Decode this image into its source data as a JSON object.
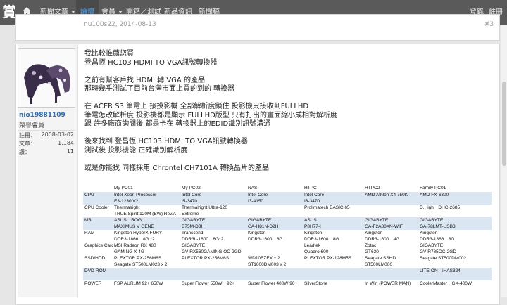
{
  "nav": {
    "logo": "賞",
    "items": [
      {
        "label": "新聞文章",
        "has_caret": true
      },
      {
        "label": "論壇",
        "active": true
      },
      {
        "label": "會員",
        "has_caret": true
      },
      {
        "label": "開箱／測試"
      },
      {
        "label": "新品資訊"
      },
      {
        "label": "新聞稿"
      }
    ],
    "login": "登錄",
    "register": "註冊"
  },
  "previous_post": {
    "meta": "nu100s22, 2014-08-13",
    "number": "#3"
  },
  "post": {
    "author": {
      "name": "nio19881109",
      "rank": "榮譽會員",
      "stats": [
        {
          "label": "註冊：",
          "value": "2008-03-02"
        },
        {
          "label": "文章：",
          "value": "1,184"
        },
        {
          "label": "讚：",
          "value": "11"
        }
      ]
    },
    "paragraphs": [
      [
        "我比較推薦您買",
        "登昌恆 HC103 HDMI TO VGA訊號轉換器"
      ],
      [
        "之前有幫客戶找 HDMI 轉 VGA 的產品",
        "那時幾乎測試了目前台灣市面上買的到的 轉換器"
      ],
      [
        "在 ACER S3 筆電上 接投影機 全部解析度鎖住 投影機只接收到FULLHD",
        "筆電怎改解析度 投影機都是顯示 FULLHD版型 只有打出的畫面縮小成相對解析度",
        "跟 許多廠商詢問後 都是卡在 轉換器上的EDID識別訊號溝通"
      ],
      [
        "後來找到 登昌恆 HC103 HDMI TO VGA訊號轉換器",
        "測試後 投影機能 正確識別解析度"
      ],
      [
        "或是你能找 同樣採用 Chrontel CH7101A 轉換晶片的產品"
      ]
    ]
  },
  "specs": {
    "headers": [
      "",
      "My PC01",
      "My PC02",
      "NAS",
      "HTPC",
      "HTPC2",
      "Family PC01"
    ],
    "rows": [
      {
        "label": "CPU",
        "alt": true,
        "cells": [
          [
            "Intel Xeon Processor",
            "E3-1230 V2"
          ],
          [
            "Intel Core",
            "I5-3470"
          ],
          [
            "Intel Core",
            "I3-4150"
          ],
          [
            "Intel Core",
            "I3-3470"
          ],
          [
            "AMD Athlon X4 750K",
            ""
          ],
          [
            "AMD FX-6300",
            ""
          ]
        ]
      },
      {
        "label": "CPU Cooler",
        "alt": false,
        "cells": [
          [
            "Thermalright",
            "TRUE Spirit 120M (BW) Rev.A"
          ],
          [
            "Thermalright Ultra-120",
            "Extreme"
          ],
          [
            "",
            ""
          ],
          [
            "Prolimatech BASIC 65",
            ""
          ],
          [
            "",
            ""
          ],
          [
            "D.High　DHC-2685",
            ""
          ]
        ]
      },
      {
        "label": "MB",
        "alt": true,
        "cells": [
          [
            "ASUS　ROG",
            "MAXIMUS V GENE"
          ],
          [
            "GIGABYTE",
            "B75M-D3H"
          ],
          [
            "GIGABYTE",
            "GA-H81N-D2H"
          ],
          [
            "ASUS",
            "P8H77-I"
          ],
          [
            "GIGABYTE",
            "GA-F2A88XN-WIFI"
          ],
          [
            "GIGABYTE",
            "GA-78LMT-USB3"
          ]
        ]
      },
      {
        "label": "RAM",
        "alt": false,
        "cells": [
          [
            "Kingston HyperX FURY",
            "DDR3-1866　8G *2"
          ],
          [
            "Transcend",
            "DDR3L-1600　8G*2"
          ],
          [
            "Kingston",
            "DDR3-1600　8G"
          ],
          [
            "Kingston",
            "DDR3-1600　8G"
          ],
          [
            "Kingston",
            "DDR3-1600　4G"
          ],
          [
            "Kingston",
            "DDR3-1866　8G"
          ]
        ]
      },
      {
        "label": "Graphics Card",
        "alt": false,
        "cells": [
          [
            "MSI Radeon RX 480",
            "GAMING X 4G"
          ],
          [
            "GIGABYTE",
            "GV-RX560GAMING OC-2GD"
          ],
          [
            "",
            ""
          ],
          [
            "Leadtek",
            "Quadro 600"
          ],
          [
            "Zotac",
            "GT630"
          ],
          [
            "GIGABYTE",
            "GV-R785OC-2GD"
          ]
        ]
      },
      {
        "label": "SSD/HDD",
        "alt": false,
        "cells": [
          [
            "PLEXTOR PX-256M6S",
            "Seagate ST500LM023 x 2"
          ],
          [
            "PLEXTOR PX-256M6S",
            ""
          ],
          [
            "WD10EZEX x 2",
            "ST1000DM003 x 2"
          ],
          [
            "PLEXTOR PX-128M5S",
            ""
          ],
          [
            "Seagate SSHD",
            "ST500LM000"
          ],
          [
            "Seagate ST500DM002",
            ""
          ]
        ]
      },
      {
        "label": "DVD-ROM",
        "alt": true,
        "cells": [
          [
            "",
            ""
          ],
          [
            "",
            ""
          ],
          [
            "",
            ""
          ],
          [
            "",
            ""
          ],
          [
            "",
            ""
          ],
          [
            "LITE-ON　iHAS324",
            ""
          ]
        ]
      },
      {
        "label": "POWER",
        "alt": false,
        "cells": [
          [
            "FSP AURUM 92+ 650W",
            ""
          ],
          [
            "Super Flower 550W　92+",
            ""
          ],
          [
            "Super Flower 400W 90+",
            ""
          ],
          [
            "SilverStone",
            ""
          ],
          [
            "In Win (POWER MAN)",
            ""
          ],
          [
            "CoolerMaster　GX-400W",
            ""
          ]
        ]
      }
    ]
  },
  "colors": {
    "nav_bg": "#5a5a5a",
    "active_tab": "#4ea3e8",
    "alt_row": "#dbe6f3",
    "username": "#2a6ebb"
  }
}
